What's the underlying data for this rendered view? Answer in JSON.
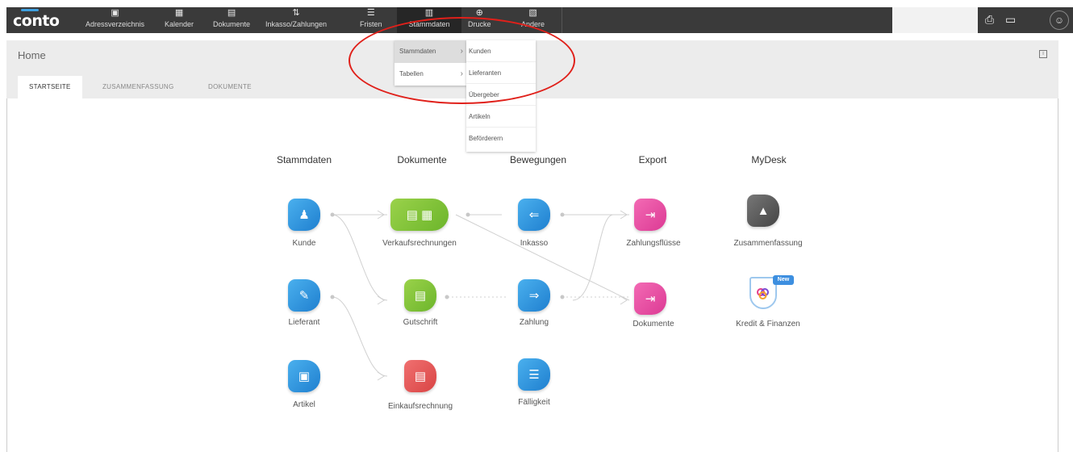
{
  "app": {
    "logo": "conto"
  },
  "nav": [
    {
      "label": "Adressverzeichnis",
      "icon": "▣"
    },
    {
      "label": "Kalender",
      "icon": "▦"
    },
    {
      "label": "Dokumente",
      "icon": "▤"
    },
    {
      "label": "Inkasso/Zahlungen",
      "icon": "⇅"
    },
    {
      "label": "Fristen",
      "icon": "☰"
    },
    {
      "label": "Stammdaten",
      "icon": "▥"
    },
    {
      "label": "Drucke",
      "icon": "⊕"
    },
    {
      "label": "Andere",
      "icon": "▧"
    }
  ],
  "toolbar_right": {
    "print_icon": "⎙",
    "chat_icon": "▭",
    "user_icon": "☺"
  },
  "header": {
    "title": "Home",
    "tabs": [
      "STARTSEITE",
      "ZUSAMMENFASSUNG",
      "DOKUMENTE"
    ]
  },
  "dropdown": {
    "items": [
      {
        "label": "Stammdaten"
      },
      {
        "label": "Tabellen"
      }
    ],
    "submenu": [
      "Kunden",
      "Lieferanten",
      "Übergeber",
      "Artikeln",
      "Beförderern"
    ]
  },
  "dashboard": {
    "columns": [
      "Stammdaten",
      "Dokumente",
      "Bewegungen",
      "Export",
      "MyDesk"
    ],
    "nodes": {
      "kunde": "Kunde",
      "lieferant": "Lieferant",
      "artikel": "Artikel",
      "verkauf": "Verkaufsrechnungen",
      "gutschrift": "Gutschrift",
      "einkauf": "Einkaufsrechnung",
      "inkasso": "Inkasso",
      "zahlung": "Zahlung",
      "faelligkeit": "Fälligkeit",
      "zahlungsfluesse": "Zahlungsflüsse",
      "dokumente": "Dokumente",
      "zusammenfassung": "Zusammenfassung",
      "kredit": "Kredit & Finanzen"
    },
    "badge": "New"
  }
}
